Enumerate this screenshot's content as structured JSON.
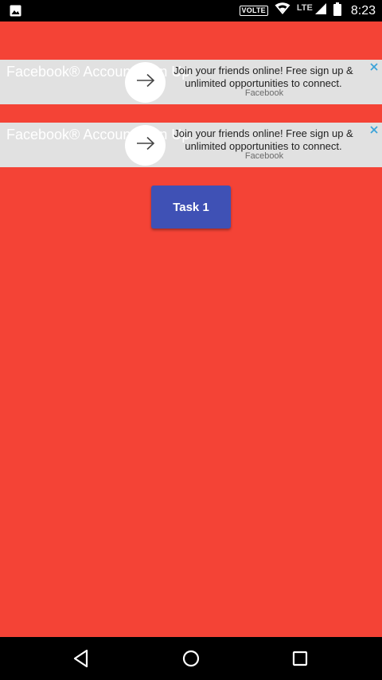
{
  "status_bar": {
    "time": "8:23",
    "volte_label": "VOLTE",
    "network_label": "LTE",
    "icons": [
      "image-notification-icon",
      "wifi-icon",
      "cell-signal-icon",
      "battery-icon"
    ]
  },
  "ads": [
    {
      "title": "Facebook® Account Sign Up",
      "description": "Join your friends online! Free sign up & unlimited opportunities to connect.",
      "advertiser": "Facebook",
      "icons": [
        "arrow-right-icon",
        "close-icon"
      ]
    },
    {
      "title": "Facebook® Account Sign Up",
      "description": "Join your friends online! Free sign up & unlimited opportunities to connect.",
      "advertiser": "Facebook",
      "icons": [
        "arrow-right-icon",
        "close-icon"
      ]
    }
  ],
  "main": {
    "task_button_label": "Task 1"
  },
  "nav_bar": {
    "icons": [
      "back-icon",
      "home-icon",
      "recents-icon"
    ]
  },
  "colors": {
    "background": "#f44336",
    "button": "#3f51b5",
    "ad_background": "#e1e1e1",
    "close_accent": "#3aa3d9"
  }
}
